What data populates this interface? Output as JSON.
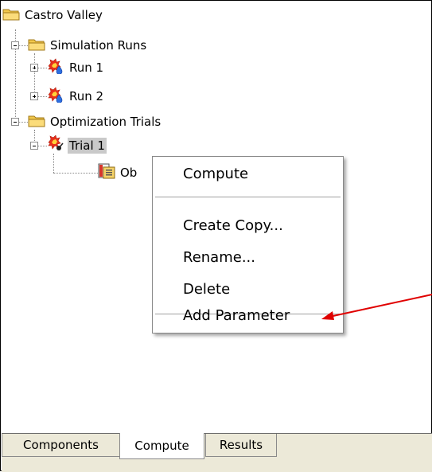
{
  "tree": {
    "root": {
      "label": "Castro Valley",
      "icon": "folder-icon"
    },
    "simulation_runs": {
      "label": "Simulation Runs",
      "icon": "folder-icon",
      "items": [
        {
          "label": "Run 1",
          "icon": "simulation-run-icon"
        },
        {
          "label": "Run 2",
          "icon": "simulation-run-icon"
        }
      ]
    },
    "optimization_trials": {
      "label": "Optimization Trials",
      "icon": "folder-icon",
      "items": [
        {
          "label": "Trial 1",
          "icon": "optimization-trial-icon",
          "selected": true,
          "children": [
            {
              "label": "Ob",
              "icon": "objective-icon"
            }
          ]
        }
      ]
    }
  },
  "context_menu": {
    "items": [
      {
        "label": "Compute"
      },
      {
        "label": "Create Copy..."
      },
      {
        "label": "Rename..."
      },
      {
        "label": "Delete"
      },
      {
        "label": "Add Parameter"
      }
    ]
  },
  "tabs": [
    {
      "label": "Components",
      "active": false
    },
    {
      "label": "Compute",
      "active": true
    },
    {
      "label": "Results",
      "active": false
    }
  ],
  "annotation": {
    "arrow_color": "#e00000"
  },
  "colors": {
    "folder": "#f2c84b",
    "selection": "#c9c9c9",
    "tab_bg": "#ece9d8"
  }
}
